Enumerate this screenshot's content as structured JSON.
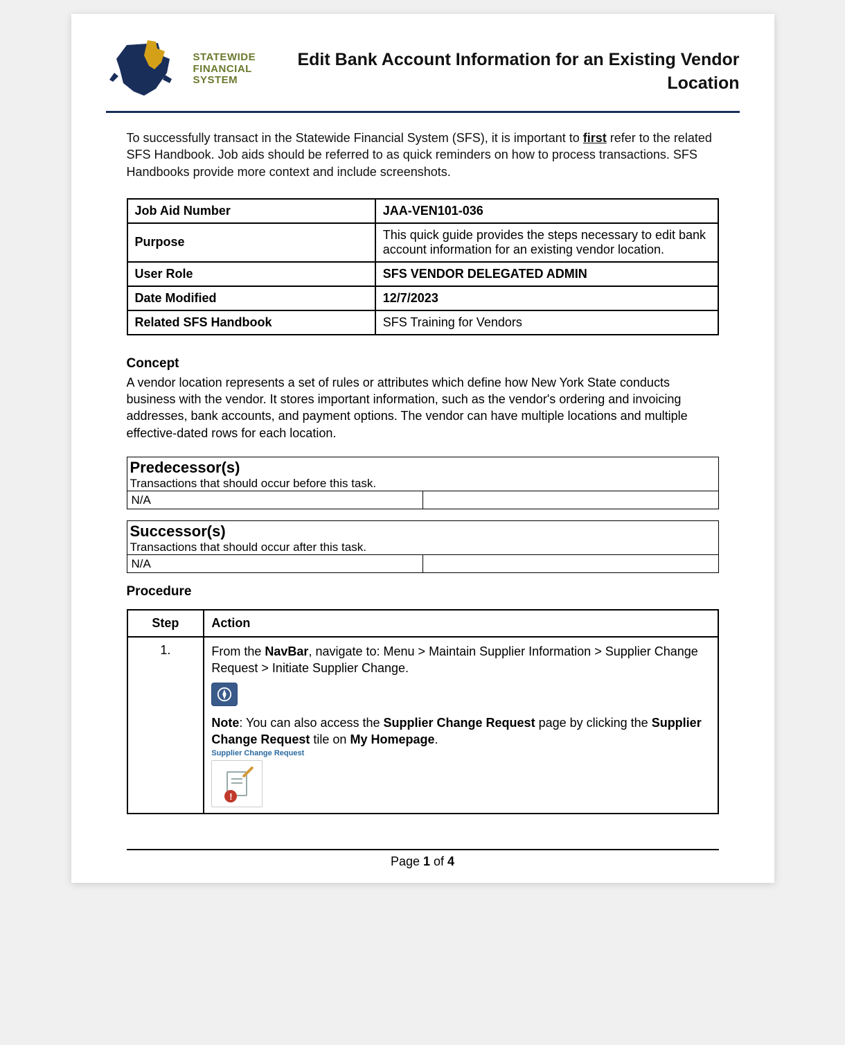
{
  "logo": {
    "line1": "STATEWIDE",
    "line2": "FINANCIAL",
    "line3": "SYSTEM"
  },
  "page_title": "Edit Bank Account Information for an Existing Vendor Location",
  "intro": {
    "pre": "To successfully transact in the Statewide Financial System (SFS), it is important to ",
    "emph": "first",
    "post": " refer to the related SFS Handbook. Job aids should be referred to as quick reminders on how to process transactions. SFS Handbooks provide more context and include screenshots."
  },
  "meta": [
    {
      "label": "Job Aid Number",
      "value": "JAA-VEN101-036",
      "bold": true
    },
    {
      "label": "Purpose",
      "value": "This quick guide provides the steps necessary to edit bank account information for an existing vendor location.",
      "bold": false
    },
    {
      "label": "User Role",
      "value": "SFS VENDOR DELEGATED ADMIN",
      "bold": true
    },
    {
      "label": "Date Modified",
      "value": "12/7/2023",
      "bold": true
    },
    {
      "label": "Related SFS Handbook",
      "value": "SFS Training for Vendors",
      "bold": false
    }
  ],
  "concept": {
    "heading": "Concept",
    "body": "A vendor location represents a set of rules or attributes which define how New York State conducts business with the vendor. It stores important information, such as the vendor's ordering and invoicing addresses, bank accounts, and payment options. The vendor can have multiple locations and multiple effective-dated rows for each location."
  },
  "predecessor": {
    "title": "Predecessor(s)",
    "subtitle": "Transactions that should occur before this task.",
    "value": "N/A"
  },
  "successor": {
    "title": "Successor(s)",
    "subtitle": "Transactions that should occur after this task.",
    "value": "N/A"
  },
  "procedure": {
    "heading": "Procedure",
    "columns": {
      "step": "Step",
      "action": "Action"
    },
    "rows": [
      {
        "step": "1.",
        "line1_pre": "From the ",
        "line1_b1": "NavBar",
        "line1_post": ", navigate to: Menu > Maintain Supplier Information > Supplier Change Request > Initiate Supplier Change.",
        "note_label": "Note",
        "note_mid1": ": You can also access the ",
        "note_b2": "Supplier Change Request",
        "note_mid2": " page by clicking the ",
        "note_b3": "Supplier Change Request",
        "note_mid3": " tile on ",
        "note_b4": "My Homepage",
        "note_end": ".",
        "tile_caption": "Supplier Change Request",
        "tile_badge": "!"
      }
    ]
  },
  "footer": {
    "pre": "Page ",
    "current": "1",
    "mid": " of ",
    "total": "4"
  }
}
